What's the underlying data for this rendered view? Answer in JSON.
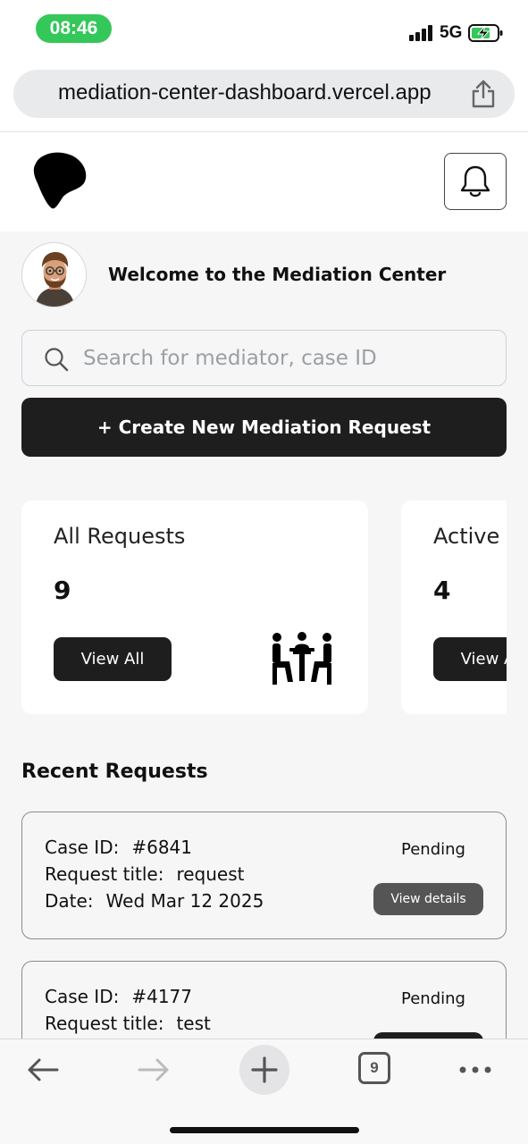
{
  "status_bar": {
    "time": "08:46",
    "network": "5G",
    "icons": [
      "signal-icon",
      "battery-charging-icon"
    ],
    "time_pill_color": "#34c759"
  },
  "browser": {
    "url": "mediation-center-dashboard.vercel.app",
    "icons": [
      "share-icon"
    ]
  },
  "header": {
    "icons": [
      "logo-icon",
      "bell-icon"
    ]
  },
  "welcome": {
    "text": "Welcome to the Mediation Center",
    "avatar": "avatar-icon"
  },
  "search": {
    "placeholder": "Search for mediator, case ID",
    "value": ""
  },
  "create_button": {
    "label": "+ Create New Mediation Request"
  },
  "stats": [
    {
      "title": "All Requests",
      "count": "9",
      "button": "View All",
      "icon": "meeting-table-icon"
    },
    {
      "title": "Active",
      "count": "4",
      "button": "View All"
    }
  ],
  "recent": {
    "title": "Recent Requests",
    "labels": {
      "case_id": "Case ID:",
      "title": "Request title:",
      "date": "Date:"
    },
    "items": [
      {
        "case_id": "#6841",
        "title": "request",
        "date": "Wed Mar 12 2025",
        "status": "Pending",
        "button": "View details"
      },
      {
        "case_id": "#4177",
        "title": "test",
        "status": "Pending"
      }
    ]
  },
  "toolbar": {
    "tab_count": "9",
    "icons": [
      "back-arrow-icon",
      "forward-arrow-icon",
      "new-tab-plus-icon",
      "tabs-icon",
      "more-icon"
    ]
  },
  "colors": {
    "primary_button": "#1e1e1e",
    "page_background": "#f6f6f6",
    "details_button": "#555555"
  }
}
